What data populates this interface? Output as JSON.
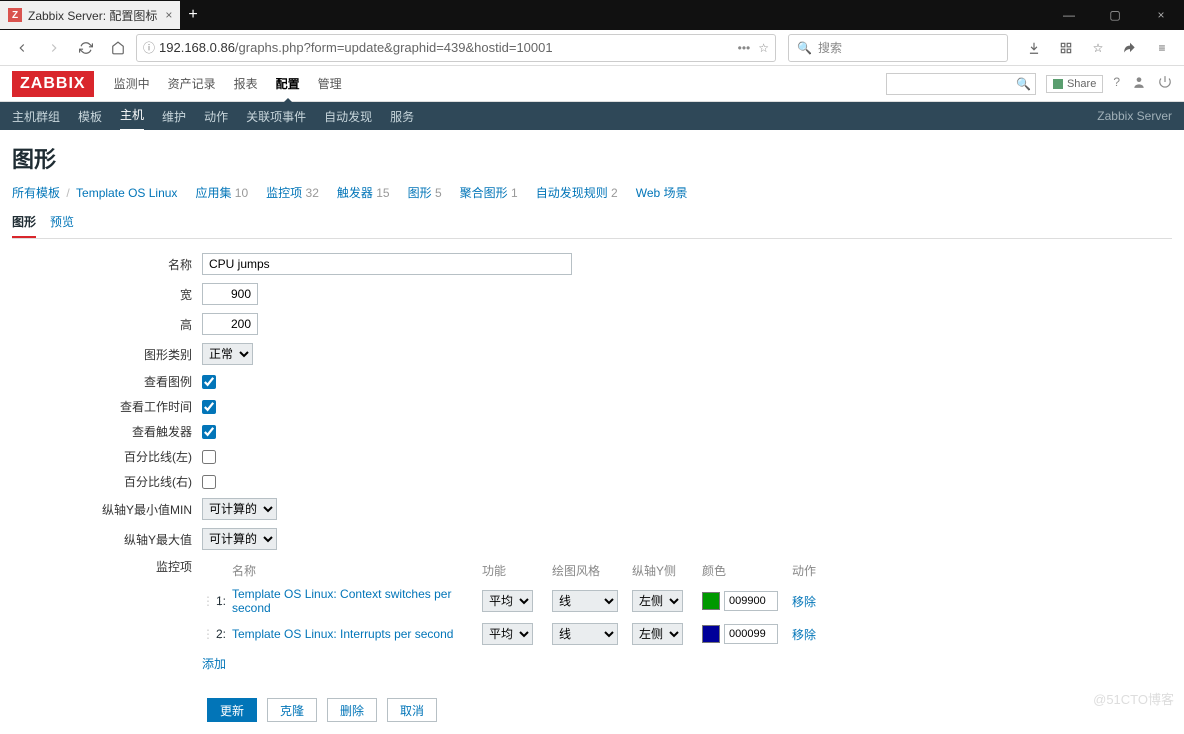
{
  "browser": {
    "tab_title": "Zabbix Server: 配置图标",
    "url_host": "192.168.0.86",
    "url_path": "/graphs.php?form=update&graphid=439&hostid=10001",
    "search_placeholder": "搜索"
  },
  "header": {
    "logo": "ZABBIX",
    "menu": [
      "监测中",
      "资产记录",
      "报表",
      "配置",
      "管理"
    ],
    "active_menu_idx": 3,
    "share": "Share",
    "server_label": "Zabbix Server"
  },
  "subnav": {
    "items": [
      "主机群组",
      "模板",
      "主机",
      "维护",
      "动作",
      "关联项事件",
      "自动发现",
      "服务"
    ],
    "active_idx": 2
  },
  "page_title": "图形",
  "breadcrumb": {
    "all_templates": "所有模板",
    "template": "Template OS Linux",
    "items": [
      {
        "label": "应用集",
        "count": "10"
      },
      {
        "label": "监控项",
        "count": "32"
      },
      {
        "label": "触发器",
        "count": "15"
      },
      {
        "label": "图形",
        "count": "5"
      },
      {
        "label": "聚合图形",
        "count": "1"
      },
      {
        "label": "自动发现规则",
        "count": "2"
      },
      {
        "label": "Web 场景",
        "count": ""
      }
    ]
  },
  "tabs": {
    "graph": "图形",
    "preview": "预览"
  },
  "form": {
    "labels": {
      "name": "名称",
      "width": "宽",
      "height": "高",
      "type": "图形类别",
      "legend": "查看图例",
      "worktime": "查看工作时间",
      "triggers": "查看触发器",
      "pct_left": "百分比线(左)",
      "pct_right": "百分比线(右)",
      "ymin": "纵轴Y最小值MIN",
      "ymax": "纵轴Y最大值",
      "items": "监控项"
    },
    "values": {
      "name": "CPU jumps",
      "width": "900",
      "height": "200",
      "type": "正常",
      "ymin": "可计算的",
      "ymax": "可计算的",
      "legend": true,
      "worktime": true,
      "triggers": true,
      "pct_left": false,
      "pct_right": false
    }
  },
  "items_table": {
    "headers": {
      "name": "名称",
      "func": "功能",
      "style": "绘图风格",
      "side": "纵轴Y侧",
      "color": "颜色",
      "action": "动作"
    },
    "rows": [
      {
        "idx": "1:",
        "name": "Template OS Linux: Context switches per second",
        "func": "平均",
        "style": "线",
        "side": "左侧",
        "color": "009900",
        "swatch": "#009900",
        "action": "移除"
      },
      {
        "idx": "2:",
        "name": "Template OS Linux: Interrupts per second",
        "func": "平均",
        "style": "线",
        "side": "左侧",
        "color": "000099",
        "swatch": "#000099",
        "action": "移除"
      }
    ],
    "add": "添加"
  },
  "actions": {
    "update": "更新",
    "clone": "克隆",
    "delete": "删除",
    "cancel": "取消"
  },
  "watermark": "@51CTO博客"
}
